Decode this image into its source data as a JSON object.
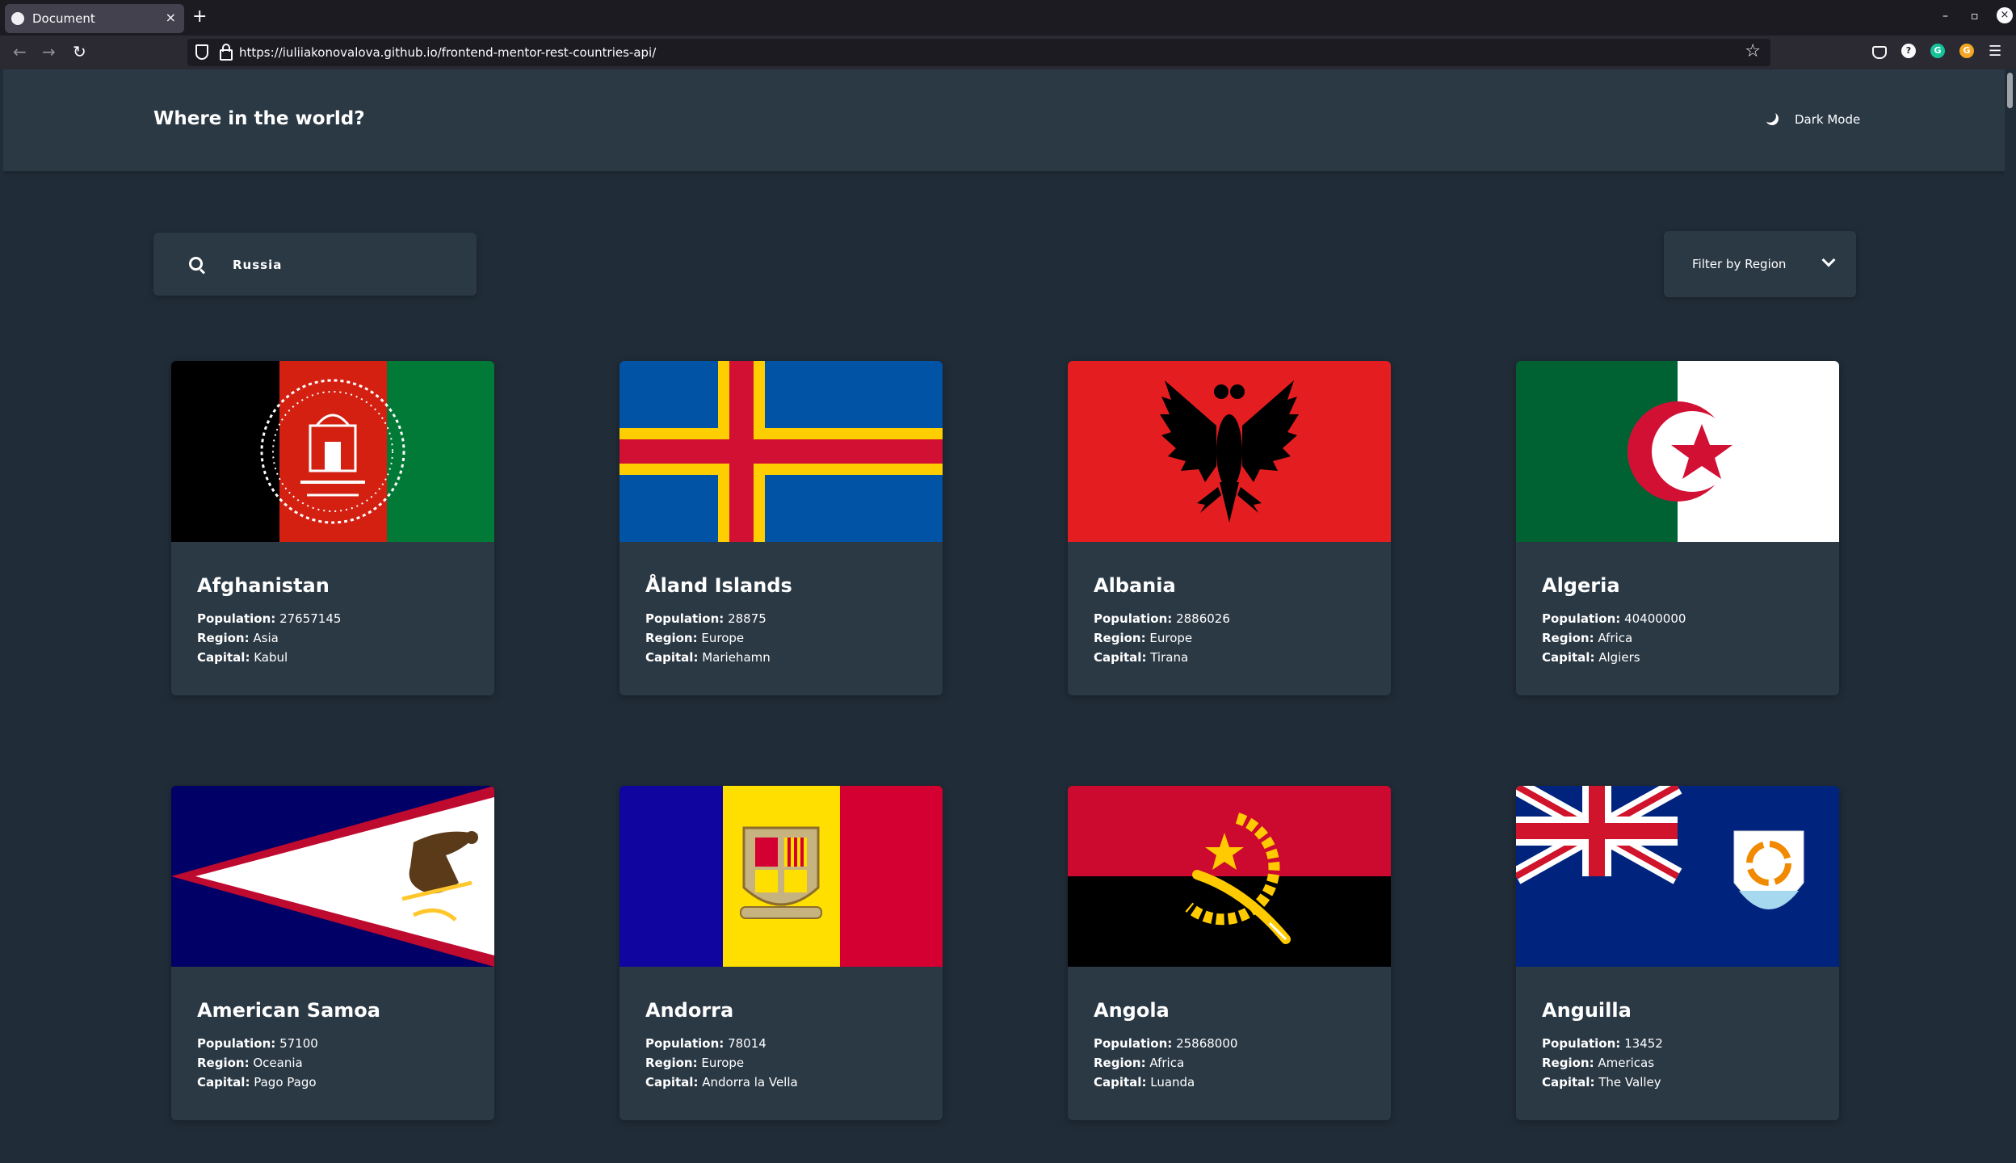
{
  "browser": {
    "tab_title": "Document",
    "url": "https://iuliiakonovalova.github.io/frontend-mentor-rest-countries-api/"
  },
  "header": {
    "title": "Where in the world?",
    "dark_mode_label": "Dark Mode"
  },
  "search": {
    "value": "Russia"
  },
  "filter": {
    "label": "Filter by Region"
  },
  "labels": {
    "population": "Population:",
    "region": "Region:",
    "capital": "Capital:"
  },
  "countries": [
    {
      "name": "Afghanistan",
      "population": "27657145",
      "region": "Asia",
      "capital": "Kabul"
    },
    {
      "name": "Åland Islands",
      "population": "28875",
      "region": "Europe",
      "capital": "Mariehamn"
    },
    {
      "name": "Albania",
      "population": "2886026",
      "region": "Europe",
      "capital": "Tirana"
    },
    {
      "name": "Algeria",
      "population": "40400000",
      "region": "Africa",
      "capital": "Algiers"
    },
    {
      "name": "American Samoa",
      "population": "57100",
      "region": "Oceania",
      "capital": "Pago Pago"
    },
    {
      "name": "Andorra",
      "population": "78014",
      "region": "Europe",
      "capital": "Andorra la Vella"
    },
    {
      "name": "Angola",
      "population": "25868000",
      "region": "Africa",
      "capital": "Luanda"
    },
    {
      "name": "Anguilla",
      "population": "13452",
      "region": "Americas",
      "capital": "The Valley"
    }
  ],
  "colors": {
    "background": "#202c37",
    "element": "#2b3945",
    "text": "#ffffff"
  }
}
